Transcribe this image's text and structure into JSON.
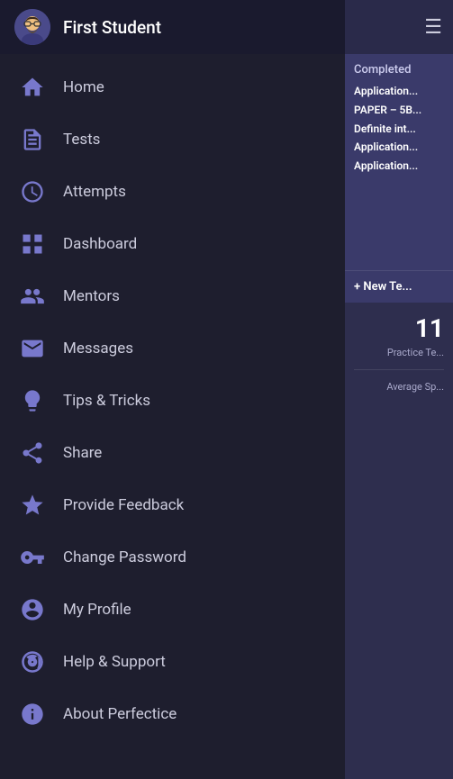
{
  "header": {
    "title": "First Student",
    "menu_icon": "☰"
  },
  "sidebar": {
    "items": [
      {
        "id": "home",
        "label": "Home",
        "icon": "home"
      },
      {
        "id": "tests",
        "label": "Tests",
        "icon": "document"
      },
      {
        "id": "attempts",
        "label": "Attempts",
        "icon": "clock"
      },
      {
        "id": "dashboard",
        "label": "Dashboard",
        "icon": "grid"
      },
      {
        "id": "mentors",
        "label": "Mentors",
        "icon": "users"
      },
      {
        "id": "messages",
        "label": "Messages",
        "icon": "envelope"
      },
      {
        "id": "tips",
        "label": "Tips & Tricks",
        "icon": "bulb"
      },
      {
        "id": "share",
        "label": "Share",
        "icon": "share"
      },
      {
        "id": "feedback",
        "label": "Provide Feedback",
        "icon": "star"
      },
      {
        "id": "password",
        "label": "Change Password",
        "icon": "key"
      },
      {
        "id": "profile",
        "label": "My Profile",
        "icon": "person-circle"
      },
      {
        "id": "help",
        "label": "Help & Support",
        "icon": "lifebuoy"
      },
      {
        "id": "about",
        "label": "About Perfectice",
        "icon": "info-circle"
      }
    ]
  },
  "right_panel": {
    "completed_label": "Completed",
    "completed_items": [
      "Application...",
      "PAPER – 5B...",
      "Definite int...",
      "Application...",
      "Application..."
    ],
    "new_test_label": "+ New Te...",
    "stat_number": "11",
    "stat_label": "Practice Te...",
    "avg_label": "Average Sp..."
  }
}
